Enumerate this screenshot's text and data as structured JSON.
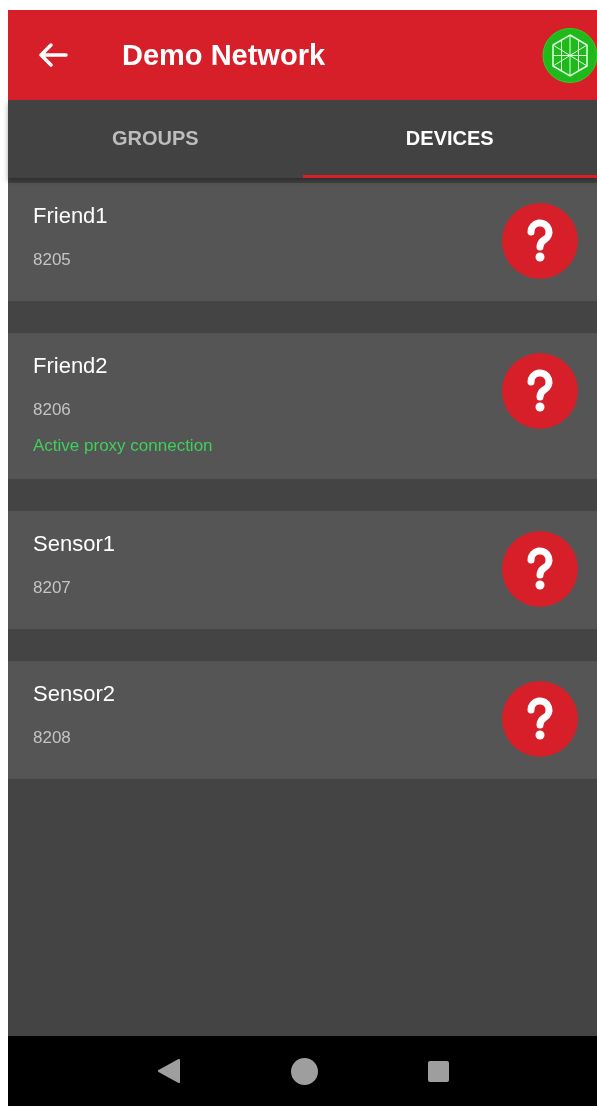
{
  "app_bar": {
    "title": "Demo Network"
  },
  "tabs": [
    {
      "label": "GROUPS",
      "selected": false
    },
    {
      "label": "DEVICES",
      "selected": true
    }
  ],
  "devices": [
    {
      "name": "Friend1",
      "address": "8205"
    },
    {
      "name": "Friend2",
      "address": "8206",
      "status": "Active proxy connection"
    },
    {
      "name": "Sensor1",
      "address": "8207"
    },
    {
      "name": "Sensor2",
      "address": "8208"
    }
  ]
}
